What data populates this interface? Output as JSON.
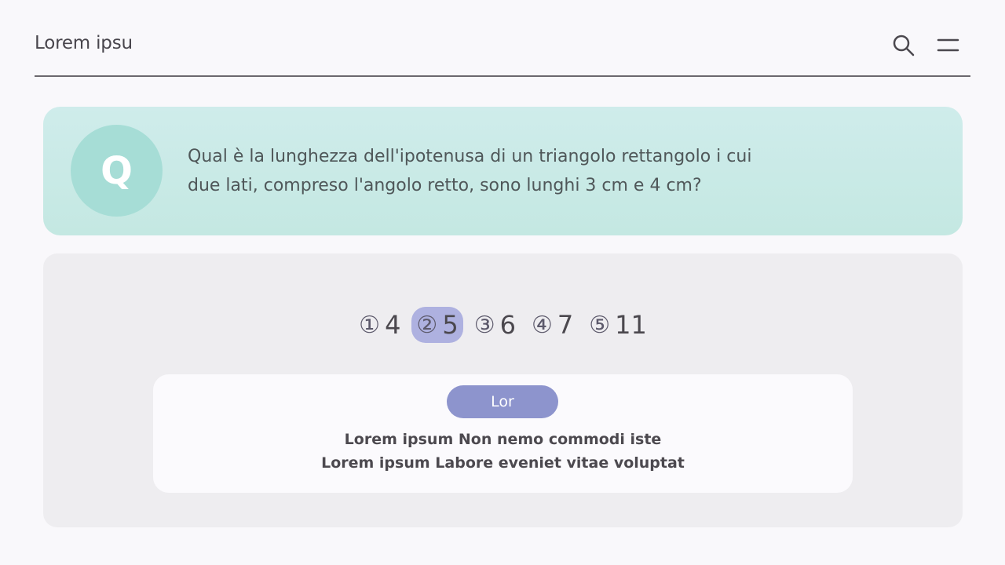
{
  "header": {
    "title": "Lorem ipsu",
    "search_icon": "search-icon",
    "menu_icon": "menu-icon"
  },
  "question": {
    "avatar_letter": "Q",
    "text": "Qual è la lunghezza dell'ipotenusa di un triangolo rettangolo i cui due lati, compreso l'angolo retto, sono lunghi 3 cm e 4 cm?"
  },
  "choices": [
    {
      "marker": "①",
      "value": "4"
    },
    {
      "marker": "②",
      "value": "5",
      "selected": true
    },
    {
      "marker": "③",
      "value": "6"
    },
    {
      "marker": "④",
      "value": "7"
    },
    {
      "marker": "⑤",
      "value": "11"
    }
  ],
  "result": {
    "button_label": "Lor",
    "line_1": "Lorem ipsum Non nemo commodi iste",
    "line_2": "Lorem ipsum Labore eveniet vitae voluptat"
  },
  "colors": {
    "background": "#f9f8fb",
    "question_card": "#cfeceb",
    "avatar": "#a6ddd6",
    "answer_panel": "#eeedf0",
    "selected_choice": "#aeb1e0",
    "button": "#8d94cd"
  }
}
